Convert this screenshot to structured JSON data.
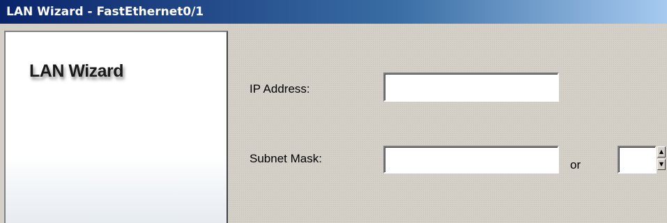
{
  "window": {
    "title": "LAN Wizard - FastEthernet0/1"
  },
  "left_panel": {
    "heading": "LAN Wizard"
  },
  "form": {
    "ip_address": {
      "label": "IP Address:",
      "value": ""
    },
    "subnet_mask": {
      "label": "Subnet Mask:",
      "value": ""
    },
    "or_label": "or",
    "prefix_length": {
      "value": ""
    },
    "spinner": {
      "up_icon": "up-arrow-icon",
      "down_icon": "down-arrow-icon"
    }
  },
  "colors": {
    "titlebar_start": "#0a246a",
    "titlebar_end": "#a6caf0",
    "dialog_background": "#d4d0c8"
  }
}
